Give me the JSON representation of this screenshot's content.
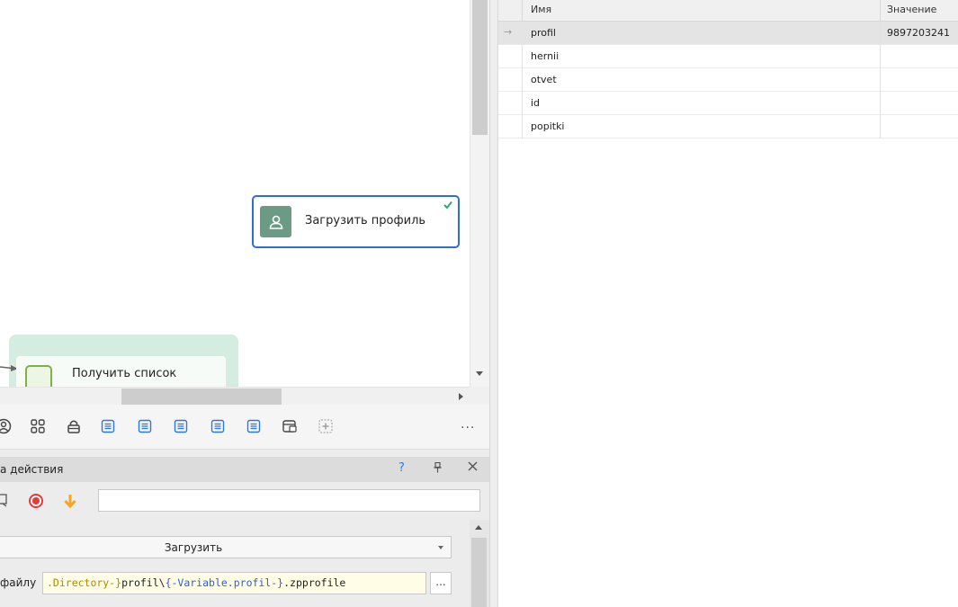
{
  "canvas": {
    "node_profile_label": "Загрузить профиль",
    "node_list_label": "Получить список"
  },
  "toolbar": {
    "more_label": "..."
  },
  "properties": {
    "title": "а действия",
    "help_label": "?",
    "mode_value": "Загрузить",
    "path_label": "файлу",
    "path_parts": [
      {
        "text": ".Directory-}",
        "kind": "y"
      },
      {
        "text": "profil\\",
        "kind": "k"
      },
      {
        "text": "{-Variable.profil-}",
        "kind": "b"
      },
      {
        "text": ".zpprofile",
        "kind": "k"
      }
    ],
    "browse_label": "..."
  },
  "variables": {
    "columns": {
      "name": "Имя",
      "value": "Значение"
    },
    "rows": [
      {
        "name": "profil",
        "value": "9897203241",
        "active": true
      },
      {
        "name": "hernii",
        "value": "",
        "active": false
      },
      {
        "name": "otvet",
        "value": "",
        "active": false
      },
      {
        "name": "id",
        "value": "",
        "active": false
      },
      {
        "name": "popitki",
        "value": "",
        "active": false
      }
    ]
  },
  "colors": {
    "accent_blue": "#2f6fd0",
    "node_green": "#6b9b84",
    "group_green": "#d5ece0",
    "record_red": "#e53935",
    "arrow_orange": "#f5a623"
  }
}
